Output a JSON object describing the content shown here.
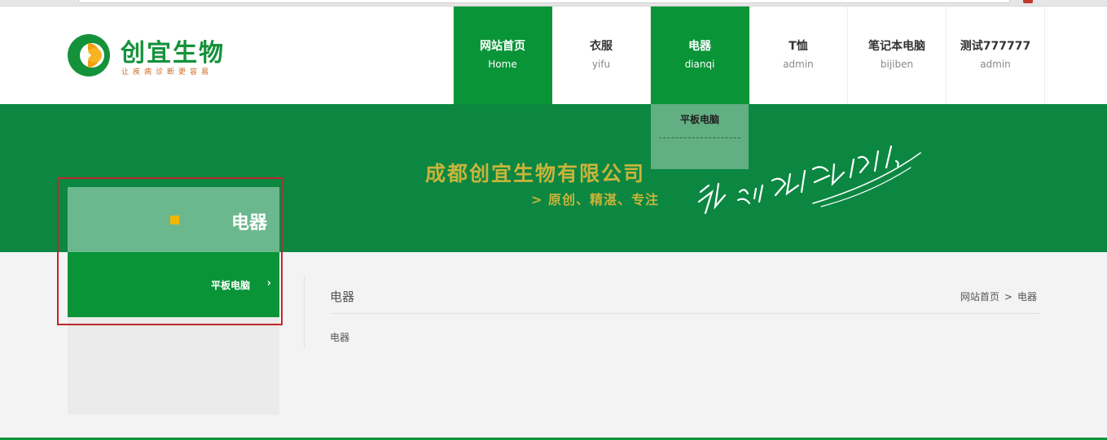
{
  "logo": {
    "name": "创宜生物",
    "slogan": "让疾病诊断更容易"
  },
  "nav": {
    "items": [
      {
        "title": "网站首页",
        "sub": "Home"
      },
      {
        "title": "衣服",
        "sub": "yifu"
      },
      {
        "title": "电器",
        "sub": "dianqi"
      },
      {
        "title": "T恤",
        "sub": "admin"
      },
      {
        "title": "笔记本电脑",
        "sub": "bijiben"
      },
      {
        "title": "测试777777",
        "sub": "admin"
      }
    ],
    "dropdown": {
      "items": [
        "平板电脑"
      ]
    }
  },
  "banner": {
    "title": "成都创宜生物有限公司",
    "subtitle": "> 原创、精湛、专注",
    "script": "让疾病诊断更容易!"
  },
  "sidebar": {
    "title": "电器",
    "items": [
      {
        "label": "平板电脑",
        "chevron": "›"
      }
    ]
  },
  "content": {
    "title": "电器",
    "body": "电器",
    "breadcrumb": {
      "home": "网站首页",
      "separator": ">",
      "current": "电器"
    }
  },
  "colors": {
    "brand_green": "#0a9438",
    "banner_green": "#0b8742",
    "gold": "#c8b43a",
    "highlight_frame": "#c1272d"
  }
}
